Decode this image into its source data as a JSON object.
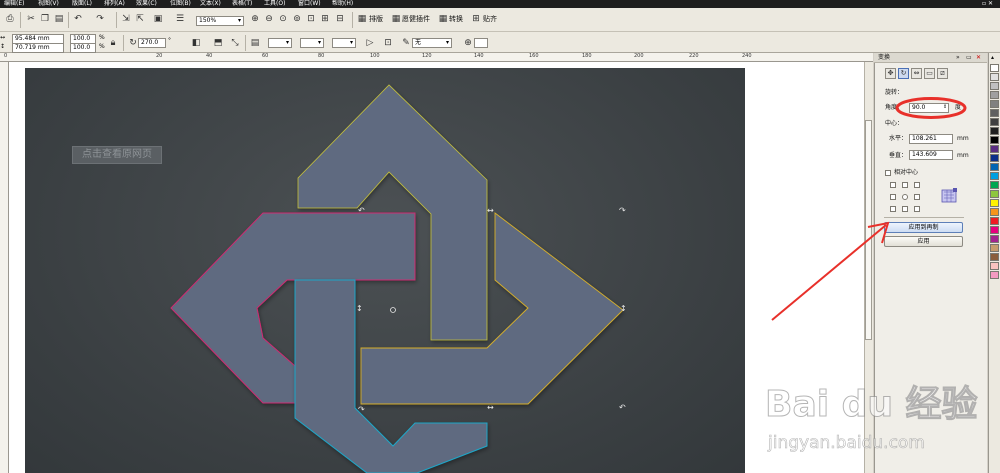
{
  "menubar": {
    "items": [
      "编辑(E)",
      "视图(V)",
      "版面(L)",
      "排列(A)",
      "效果(C)",
      "位图(B)",
      "文本(X)",
      "表格(T)",
      "工具(O)",
      "窗口(W)",
      "帮助(H)"
    ]
  },
  "toolbar": {
    "zoom": "150%",
    "arrange_label": "排版",
    "plugin_label": "愿健插件",
    "convert_label": "转换",
    "paste_label": "贴齐"
  },
  "property_bar": {
    "width": "95.484 mm",
    "height": "70.719 mm",
    "scale_x": "100.0",
    "scale_y": "100.0",
    "percent": "%",
    "rotation": "270.0",
    "degree": "°",
    "outline": "无"
  },
  "ruler": {
    "ticks": [
      "0",
      "20",
      "40",
      "60",
      "80",
      "100",
      "120",
      "140",
      "160",
      "180",
      "200",
      "220",
      "240"
    ]
  },
  "canvas": {
    "link_button": "点击查看原网页"
  },
  "docker": {
    "title": "变换",
    "section_rotate": "旋转：",
    "angle_label": "角度：",
    "angle_value": "90.0",
    "angle_unit": "度",
    "center_label": "中心：",
    "h_label": "水平：",
    "h_value": "108.261",
    "v_label": "垂直：",
    "v_value": "143.609",
    "unit_mm": "mm",
    "relative_center": "相对中心",
    "apply_copy": "应用到再制",
    "apply": "应用"
  },
  "watermark": {
    "brand": "Bai du 经验",
    "url": "jingyan.baidu.com"
  },
  "colors": {
    "shape_fill": "#5e6b80",
    "annotation_red": "#e8302a",
    "canvas_bg": "#3d4245"
  },
  "palette": [
    "#ffffff",
    "#e0e0e0",
    "#c0c0c0",
    "#a0a0a0",
    "#808080",
    "#606060",
    "#404040",
    "#202020",
    "#000000",
    "#5a2d82",
    "#0b2f8a",
    "#0065b3",
    "#00a0e0",
    "#00a651",
    "#8dc63f",
    "#fff200",
    "#f7941d",
    "#ed1c24",
    "#e6007e",
    "#a3238e",
    "#c69c6d",
    "#8b5e3c",
    "#f9c3c0",
    "#f49ac1"
  ]
}
